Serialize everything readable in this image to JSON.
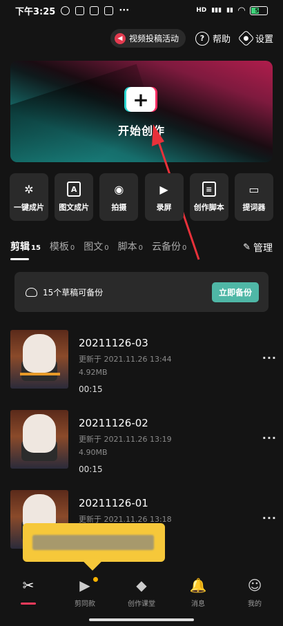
{
  "status_bar": {
    "time": "下午3:25",
    "dots": "···",
    "network": "HD",
    "battery_text": "50",
    "battery_level": 0.5
  },
  "header": {
    "promo_label": "视频投稿活动",
    "help_label": "帮助",
    "settings_label": "设置"
  },
  "hero": {
    "plus_glyph": "+",
    "label": "开始创作"
  },
  "tools": [
    {
      "label": "一键成片",
      "icon": "film-reel-icon",
      "glyph": "✲"
    },
    {
      "label": "图文成片",
      "icon": "text-to-video-icon",
      "glyph": "A"
    },
    {
      "label": "拍摄",
      "icon": "camera-icon",
      "glyph": "◉"
    },
    {
      "label": "录屏",
      "icon": "screen-record-icon",
      "glyph": "▶"
    },
    {
      "label": "创作脚本",
      "icon": "script-icon",
      "glyph": "≡"
    },
    {
      "label": "提词器",
      "icon": "teleprompter-icon",
      "glyph": "▭"
    }
  ],
  "tabs": [
    {
      "label": "剪辑",
      "count": "15"
    },
    {
      "label": "模板",
      "count": "0"
    },
    {
      "label": "图文",
      "count": "0"
    },
    {
      "label": "脚本",
      "count": "0"
    },
    {
      "label": "云备份",
      "count": "0"
    }
  ],
  "manage_label": "管理",
  "backup": {
    "text": "15个草稿可备份",
    "button": "立即备份"
  },
  "drafts": [
    {
      "title": "20211126-03",
      "updated": "更新于 2021.11.26 13:44",
      "size": "4.92MB",
      "duration": "00:15"
    },
    {
      "title": "20211126-02",
      "updated": "更新于 2021.11.26 13:19",
      "size": "4.90MB",
      "duration": "00:15"
    },
    {
      "title": "20211126-01",
      "updated": "更新于 2021.11.26 13:18",
      "size": "",
      "duration": ""
    }
  ],
  "more_glyph": "···",
  "bottom_nav": [
    {
      "label": "",
      "icon": "scissors-icon",
      "glyph": "✂"
    },
    {
      "label": "剪同款",
      "icon": "template-video-icon",
      "glyph": "▶"
    },
    {
      "label": "创作课堂",
      "icon": "graduation-cap-icon",
      "glyph": "◆"
    },
    {
      "label": "消息",
      "icon": "bell-icon",
      "glyph": "🔔"
    },
    {
      "label": "我的",
      "icon": "profile-icon",
      "glyph": "☺"
    }
  ],
  "colors": {
    "accent_teal": "#4fb7a6",
    "brand_red": "#ff3b5c",
    "toast_yellow": "#f6c83a",
    "background": "#141414"
  }
}
